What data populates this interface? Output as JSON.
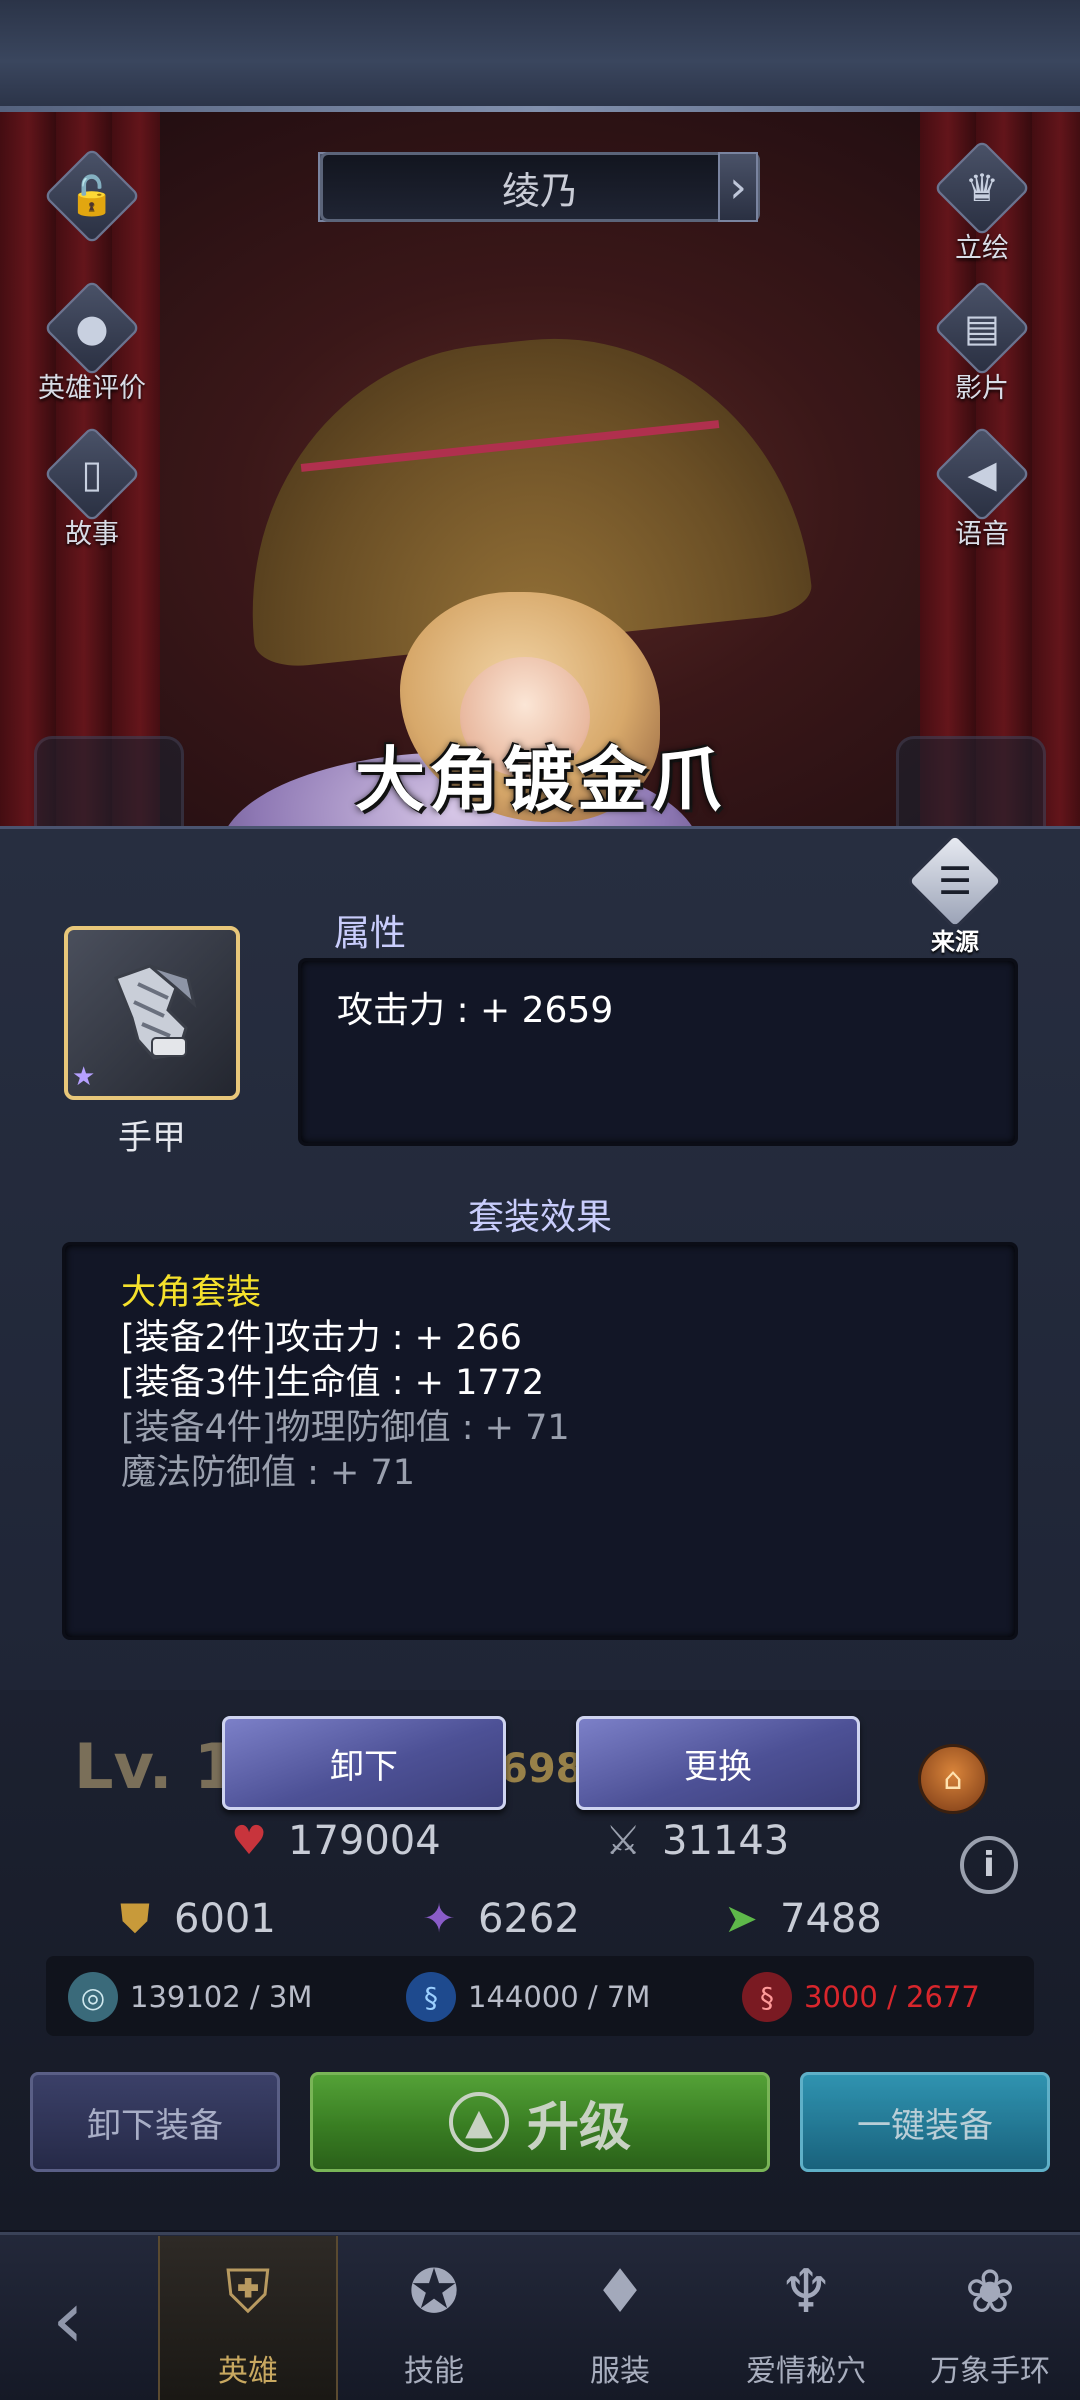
{
  "hero": {
    "name": "绫乃"
  },
  "side_buttons": {
    "lock": {
      "icon": "lock-icon"
    },
    "review": {
      "label": "英雄评价",
      "icon": "chat-icon"
    },
    "story": {
      "label": "故事",
      "icon": "book-icon"
    },
    "portrait": {
      "label": "立绘",
      "icon": "bust-icon"
    },
    "film": {
      "label": "影片",
      "icon": "film-icon"
    },
    "voice": {
      "label": "语音",
      "icon": "speaker-icon"
    }
  },
  "equipment": {
    "title": "大角镀金爪",
    "slot_label": "手甲",
    "source_label": "来源",
    "attributes_title": "属性",
    "attributes": [
      "攻击力 : + 2659"
    ],
    "set_title": "套装效果",
    "set_name": "大角套裝",
    "set_bonus_active": [
      "[装备2件]攻击力 : + 266",
      "[装备3件]生命值 : + 1772"
    ],
    "set_bonus_inactive": [
      "[装备4件]物理防御值 : + 71",
      "魔法防御值 : + 71"
    ]
  },
  "actions": {
    "unequip": "卸下",
    "replace": "更换"
  },
  "hero_stats": {
    "level_prefix": "Lv.",
    "level_value": "12",
    "level_extra": "698",
    "hp": "179004",
    "attack": "31143",
    "phys_def": "6001",
    "magic_def": "6262",
    "speed": "7488"
  },
  "resources": [
    {
      "value": "139102 / 3M",
      "icon": "coin-icon"
    },
    {
      "value": "144000 / 7M",
      "icon": "blue-spirit-icon"
    },
    {
      "value": "3000 / 2677",
      "icon": "red-spirit-icon",
      "color": "#d8262c"
    }
  ],
  "bottom_buttons": {
    "unequip_all": "卸下装备",
    "upgrade": "升级",
    "one_click": "一键装备"
  },
  "nav": {
    "items": [
      {
        "label": "英雄",
        "icon": "helmet-icon",
        "active": true
      },
      {
        "label": "技能",
        "icon": "skill-icon",
        "active": false
      },
      {
        "label": "服装",
        "icon": "dress-icon",
        "active": false
      },
      {
        "label": "爱情秘穴",
        "icon": "body-icon",
        "active": false
      },
      {
        "label": "万象手环",
        "icon": "bracelet-icon",
        "active": false
      }
    ]
  },
  "colors": {
    "set_name": "#f5e12c",
    "inactive_text": "#9aa0ae",
    "accent_gold": "#e8c77a",
    "upgrade_green": "#4fa52c"
  }
}
